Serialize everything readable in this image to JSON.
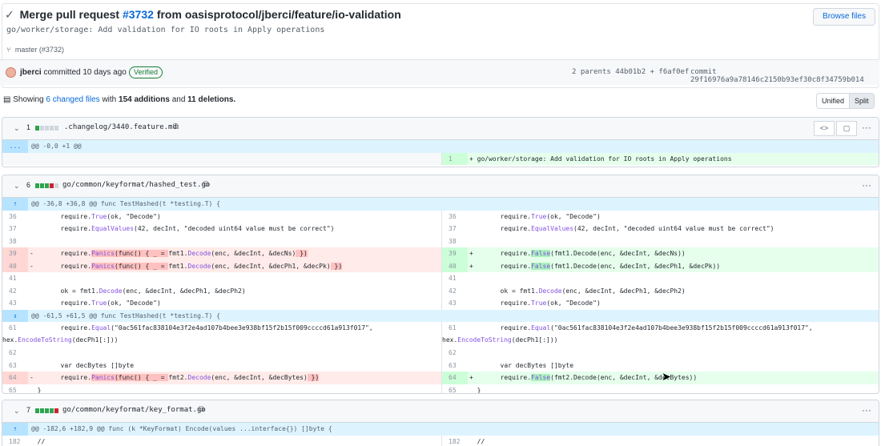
{
  "header": {
    "check": "✓",
    "title_prefix": "Merge pull request",
    "pr_number": "#3732",
    "title_suffix": "from oasisprotocol/jberci/feature/io-validation",
    "subtitle": "go/worker/storage: Add validation for IO roots in Apply operations",
    "browse_label": "Browse files",
    "branch": "master (#3732)",
    "author": "jberci",
    "committed": "committed 10 days ago",
    "verified": "Verified",
    "parents_label": "2 parents",
    "parent1": "44b01b2",
    "parent_plus": "+",
    "parent2": "f6af0ef",
    "commit_label": "commit",
    "commit_sha": "29f16976a9a78146c2150b93ef30c8f34759b014"
  },
  "toolbar": {
    "showing": "Showing",
    "changed_files": "6 changed files",
    "with": "with",
    "additions": "154 additions",
    "and": "and",
    "deletions": "11 deletions.",
    "unified": "Unified",
    "split": "Split"
  },
  "files": [
    {
      "count": "1",
      "name": ".changelog/3440.feature.md",
      "hunk": "@@ -0,0 +1 @@",
      "expand": "...",
      "line_right": "1",
      "code_right": "+ go/worker/storage: Add validation for IO roots in Apply operations"
    },
    {
      "count": "6",
      "name": "go/common/keyformat/hashed_test.go",
      "hunk1": "@@ -36,8 +36,8 @@ func TestHashed(t *testing.T) {",
      "hunk2": "@@ -61,5 +61,5 @@ func TestHashed(t *testing.T) {",
      "lines": {
        "n36": "36",
        "n37": "37",
        "n38": "38",
        "n39": "39",
        "n40": "40",
        "n41": "41",
        "n42": "42",
        "n43": "43",
        "n61": "61",
        "n62": "62",
        "n63": "63",
        "n64": "64",
        "n65": "65"
      },
      "code": {
        "require": "require.",
        "true_fn": "True",
        "decode_args": "(ok, \"Decode\")",
        "equalvalues_fn": "EqualValues",
        "equalvalues_args": "(42, decInt, \"decoded uint64 value must be correct\")",
        "panics_fn": "Panics",
        "false_fn": "False",
        "minus": "-",
        "plus": "+",
        "del39_a": "(func() { _ = ",
        "del39_b": "fmt1.",
        "del39_c": "Decode",
        "del39_d": "(enc, &decInt, &decNs)",
        "del39_e": " })",
        "add39_tail": "(fmt1.Decode(enc, &decInt, &decNs))",
        "del40_d": "(enc, &decInt, &decPh1, &decPk)",
        "add40_tail": "(fmt1.Decode(enc, &decInt, &decPh1, &decPk))",
        "line42": "ok = fmt1.",
        "line42_fn": "Decode",
        "line42_args": "(enc, &decInt, &decPh1, &decPh2)",
        "equal_fn": "Equal",
        "line61_args": "(\"0ac561fac838104e3f2e4ad107b4bee3e938bf15f2b15f009ccccd61a913f017\",",
        "line61_cont": "hex.",
        "line61_fn": "EncodeToString",
        "line61_tail": "(decPh1[:]))",
        "line63": "var decBytes []byte",
        "del64_b": "fmt2.",
        "del64_d": "(enc, &decInt, &decBytes)",
        "add64_tail": "(fmt2.Decode(enc, &decInt, &decBytes))",
        "line65": "}"
      }
    },
    {
      "count": "7",
      "name": "go/common/keyformat/key_format.go",
      "hunk": "@@ -182,6 +182,9 @@ func (k *KeyFormat) Encode(values ...interface{}) []byte {",
      "line": "182",
      "code": "//"
    }
  ],
  "icons": {
    "chevron": "⌄",
    "copy": "⧉",
    "dots": "···",
    "code": "<>",
    "file": "▢",
    "expand_up": "⇡",
    "expand_both": "⇕"
  }
}
